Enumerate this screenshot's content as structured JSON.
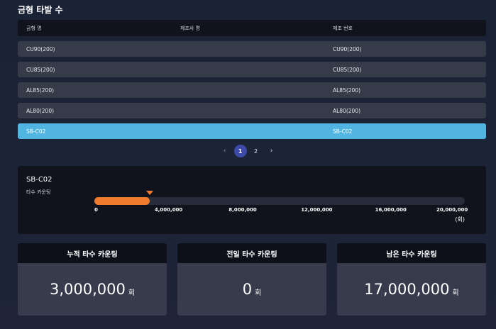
{
  "title": "금형 타발 수",
  "table": {
    "headers": [
      "금형 명",
      "제조사 명",
      "제조 번호"
    ],
    "rows": [
      {
        "name": "CU90(200)",
        "maker": "",
        "serial": "CU90(200)",
        "selected": false
      },
      {
        "name": "CU85(200)",
        "maker": "",
        "serial": "CU85(200)",
        "selected": false
      },
      {
        "name": "AL85(200)",
        "maker": "",
        "serial": "AL85(200)",
        "selected": false
      },
      {
        "name": "AL80(200)",
        "maker": "",
        "serial": "AL80(200)",
        "selected": false
      },
      {
        "name": "SB-C02",
        "maker": "",
        "serial": "SB-C02",
        "selected": true
      }
    ]
  },
  "pagination": {
    "prev": "‹",
    "pages": [
      "1",
      "2"
    ],
    "current": "1",
    "next": "›"
  },
  "gauge": {
    "name": "SB-C02",
    "label": "타수 카운팅",
    "value": 3000000,
    "max": 20000000,
    "ticks": [
      {
        "value": 0,
        "label": "0"
      },
      {
        "value": 4000000,
        "label": "4,000,000"
      },
      {
        "value": 8000000,
        "label": "8,000,000"
      },
      {
        "value": 12000000,
        "label": "12,000,000"
      },
      {
        "value": 16000000,
        "label": "16,000,000"
      },
      {
        "value": 20000000,
        "label": "20,000,000"
      }
    ],
    "unit": "(회)",
    "color": "#ef7b31"
  },
  "cards": [
    {
      "title": "누적 타수 카운팅",
      "value": "3,000,000",
      "unit": "회"
    },
    {
      "title": "전일 타수 카운팅",
      "value": "0",
      "unit": "회"
    },
    {
      "title": "남은 타수 카운팅",
      "value": "17,000,000",
      "unit": "회"
    }
  ],
  "colors": {
    "accent_selected": "#52b4e0",
    "page_active": "#3e4aa8",
    "gauge_fill": "#ef7b31"
  }
}
